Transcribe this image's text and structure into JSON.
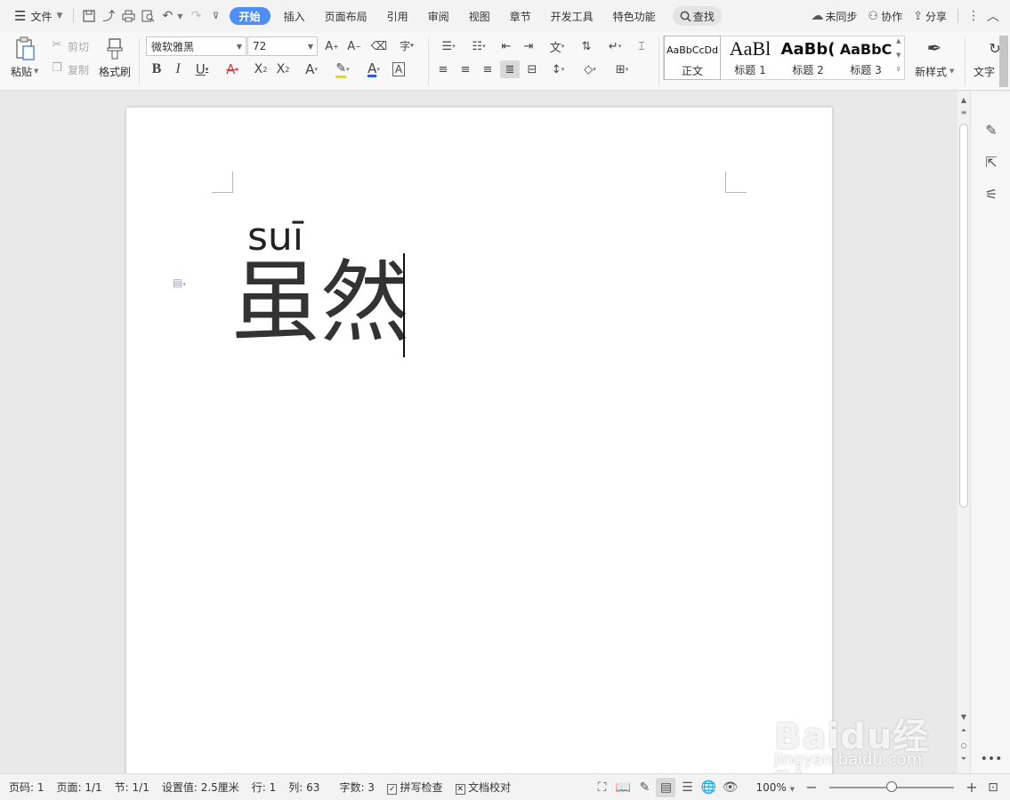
{
  "menubar": {
    "menu_icon": "hamburger-icon",
    "file_label": "文件",
    "tabs": [
      "开始",
      "插入",
      "页面布局",
      "引用",
      "审阅",
      "视图",
      "章节",
      "开发工具",
      "特色功能"
    ],
    "active_tab": "开始",
    "search_label": "查找",
    "sync_label": "未同步",
    "collab_label": "协作",
    "share_label": "分享"
  },
  "ribbon": {
    "paste_label": "粘贴",
    "cut_label": "剪切",
    "copy_label": "复制",
    "format_painter_label": "格式刷",
    "font_name": "微软雅黑",
    "font_size": "72",
    "styles": [
      {
        "preview": "AaBbCcDd",
        "name": "正文"
      },
      {
        "preview": "AaBl",
        "name": "标题 1"
      },
      {
        "preview": "AaBb(",
        "name": "标题 2"
      },
      {
        "preview": "AaBbC",
        "name": "标题 3"
      }
    ],
    "new_style_label": "新样式",
    "text_tool_label": "文字"
  },
  "document": {
    "pinyin": "suī",
    "text": "虽然"
  },
  "statusbar": {
    "page_no": "页码: 1",
    "pages": "页面: 1/1",
    "section": "节: 1/1",
    "setting": "设置值: 2.5厘米",
    "row": "行: 1",
    "col": "列: 63",
    "word_count": "字数: 3",
    "spell_check": "拼写检查",
    "doc_proof": "文档校对",
    "zoom": "100%",
    "zoom_level": 0.5
  },
  "watermark": {
    "logo": "Baidu经验",
    "url": "jingyan.baidu.com"
  },
  "colors": {
    "accent": "#4f8df7",
    "page": "#ffffff",
    "workspace": "#e9e9e9"
  }
}
